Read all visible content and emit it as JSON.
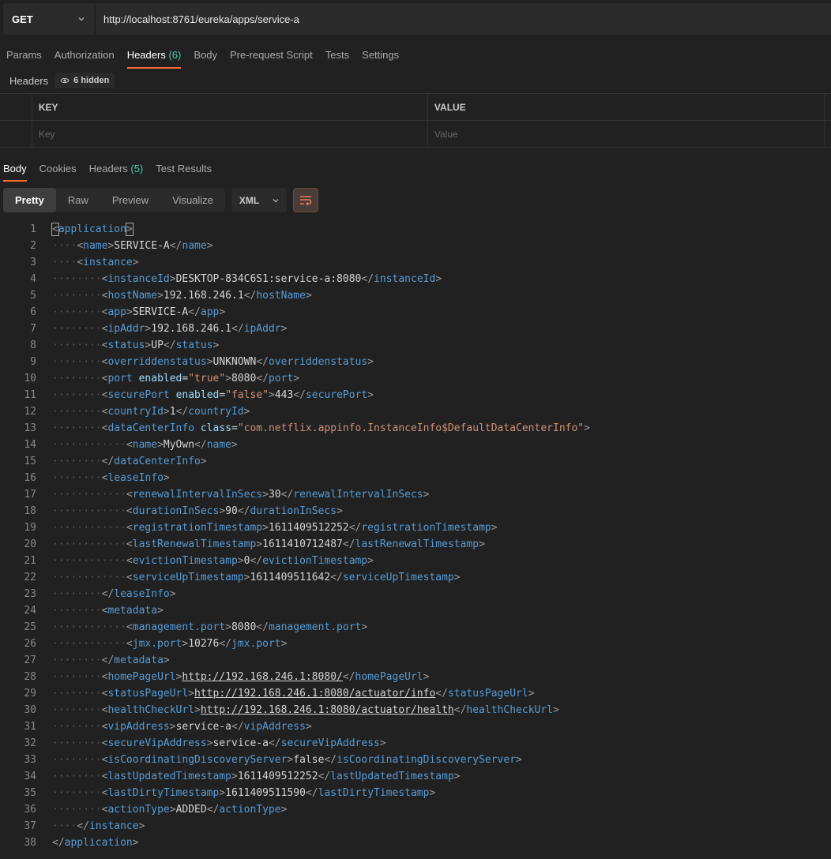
{
  "request": {
    "method": "GET",
    "url": "http://localhost:8761/eureka/apps/service-a"
  },
  "request_tabs": [
    {
      "label": "Params"
    },
    {
      "label": "Authorization"
    },
    {
      "label": "Headers",
      "count": "(6)"
    },
    {
      "label": "Body"
    },
    {
      "label": "Pre-request Script"
    },
    {
      "label": "Tests"
    },
    {
      "label": "Settings"
    }
  ],
  "headers_section": {
    "label": "Headers",
    "hidden_label": "6 hidden"
  },
  "kv_table": {
    "key_header": "KEY",
    "value_header": "VALUE",
    "key_placeholder": "Key",
    "value_placeholder": "Value"
  },
  "response_tabs": [
    {
      "label": "Body"
    },
    {
      "label": "Cookies"
    },
    {
      "label": "Headers",
      "count": "(5)"
    },
    {
      "label": "Test Results"
    }
  ],
  "view_modes": [
    "Pretty",
    "Raw",
    "Preview",
    "Visualize"
  ],
  "format": "XML",
  "colors": {
    "accent": "#ff6c37",
    "tag": "#569cd6",
    "attr": "#9cdcfe",
    "attr_value": "#ce9178",
    "count": "#4ec9b0"
  },
  "code_lines": [
    {
      "n": "1",
      "i": 0,
      "tokens": [
        [
          "br",
          "<"
        ],
        [
          "tg",
          "application"
        ],
        [
          "br",
          ">"
        ]
      ]
    },
    {
      "n": "2",
      "i": 1,
      "tokens": [
        [
          "br",
          "<"
        ],
        [
          "tg",
          "name"
        ],
        [
          "br",
          ">"
        ],
        [
          "tx",
          "SERVICE-A"
        ],
        [
          "br",
          "</"
        ],
        [
          "tg",
          "name"
        ],
        [
          "br",
          ">"
        ]
      ]
    },
    {
      "n": "3",
      "i": 1,
      "tokens": [
        [
          "br",
          "<"
        ],
        [
          "tg",
          "instance"
        ],
        [
          "br",
          ">"
        ]
      ]
    },
    {
      "n": "4",
      "i": 2,
      "tokens": [
        [
          "br",
          "<"
        ],
        [
          "tg",
          "instanceId"
        ],
        [
          "br",
          ">"
        ],
        [
          "tx",
          "DESKTOP-834C6S1:service-a:8080"
        ],
        [
          "br",
          "</"
        ],
        [
          "tg",
          "instanceId"
        ],
        [
          "br",
          ">"
        ]
      ]
    },
    {
      "n": "5",
      "i": 2,
      "tokens": [
        [
          "br",
          "<"
        ],
        [
          "tg",
          "hostName"
        ],
        [
          "br",
          ">"
        ],
        [
          "tx",
          "192.168.246.1"
        ],
        [
          "br",
          "</"
        ],
        [
          "tg",
          "hostName"
        ],
        [
          "br",
          ">"
        ]
      ]
    },
    {
      "n": "6",
      "i": 2,
      "tokens": [
        [
          "br",
          "<"
        ],
        [
          "tg",
          "app"
        ],
        [
          "br",
          ">"
        ],
        [
          "tx",
          "SERVICE-A"
        ],
        [
          "br",
          "</"
        ],
        [
          "tg",
          "app"
        ],
        [
          "br",
          ">"
        ]
      ]
    },
    {
      "n": "7",
      "i": 2,
      "tokens": [
        [
          "br",
          "<"
        ],
        [
          "tg",
          "ipAddr"
        ],
        [
          "br",
          ">"
        ],
        [
          "tx",
          "192.168.246.1"
        ],
        [
          "br",
          "</"
        ],
        [
          "tg",
          "ipAddr"
        ],
        [
          "br",
          ">"
        ]
      ]
    },
    {
      "n": "8",
      "i": 2,
      "tokens": [
        [
          "br",
          "<"
        ],
        [
          "tg",
          "status"
        ],
        [
          "br",
          ">"
        ],
        [
          "tx",
          "UP"
        ],
        [
          "br",
          "</"
        ],
        [
          "tg",
          "status"
        ],
        [
          "br",
          ">"
        ]
      ]
    },
    {
      "n": "9",
      "i": 2,
      "tokens": [
        [
          "br",
          "<"
        ],
        [
          "tg",
          "overriddenstatus"
        ],
        [
          "br",
          ">"
        ],
        [
          "tx",
          "UNKNOWN"
        ],
        [
          "br",
          "</"
        ],
        [
          "tg",
          "overriddenstatus"
        ],
        [
          "br",
          ">"
        ]
      ]
    },
    {
      "n": "10",
      "i": 2,
      "tokens": [
        [
          "br",
          "<"
        ],
        [
          "tg",
          "port"
        ],
        [
          "tx",
          " "
        ],
        [
          "at",
          "enabled"
        ],
        [
          "tx",
          "="
        ],
        [
          "av",
          "\"true\""
        ],
        [
          "br",
          ">"
        ],
        [
          "tx",
          "8080"
        ],
        [
          "br",
          "</"
        ],
        [
          "tg",
          "port"
        ],
        [
          "br",
          ">"
        ]
      ]
    },
    {
      "n": "11",
      "i": 2,
      "tokens": [
        [
          "br",
          "<"
        ],
        [
          "tg",
          "securePort"
        ],
        [
          "tx",
          " "
        ],
        [
          "at",
          "enabled"
        ],
        [
          "tx",
          "="
        ],
        [
          "av",
          "\"false\""
        ],
        [
          "br",
          ">"
        ],
        [
          "tx",
          "443"
        ],
        [
          "br",
          "</"
        ],
        [
          "tg",
          "securePort"
        ],
        [
          "br",
          ">"
        ]
      ]
    },
    {
      "n": "12",
      "i": 2,
      "tokens": [
        [
          "br",
          "<"
        ],
        [
          "tg",
          "countryId"
        ],
        [
          "br",
          ">"
        ],
        [
          "tx",
          "1"
        ],
        [
          "br",
          "</"
        ],
        [
          "tg",
          "countryId"
        ],
        [
          "br",
          ">"
        ]
      ]
    },
    {
      "n": "13",
      "i": 2,
      "tokens": [
        [
          "br",
          "<"
        ],
        [
          "tg",
          "dataCenterInfo"
        ],
        [
          "tx",
          " "
        ],
        [
          "at",
          "class"
        ],
        [
          "tx",
          "="
        ],
        [
          "av",
          "\"com.netflix.appinfo.InstanceInfo$DefaultDataCenterInfo\""
        ],
        [
          "br",
          ">"
        ]
      ]
    },
    {
      "n": "14",
      "i": 3,
      "tokens": [
        [
          "br",
          "<"
        ],
        [
          "tg",
          "name"
        ],
        [
          "br",
          ">"
        ],
        [
          "tx",
          "MyOwn"
        ],
        [
          "br",
          "</"
        ],
        [
          "tg",
          "name"
        ],
        [
          "br",
          ">"
        ]
      ]
    },
    {
      "n": "15",
      "i": 2,
      "tokens": [
        [
          "br",
          "</"
        ],
        [
          "tg",
          "dataCenterInfo"
        ],
        [
          "br",
          ">"
        ]
      ]
    },
    {
      "n": "16",
      "i": 2,
      "tokens": [
        [
          "br",
          "<"
        ],
        [
          "tg",
          "leaseInfo"
        ],
        [
          "br",
          ">"
        ]
      ]
    },
    {
      "n": "17",
      "i": 3,
      "tokens": [
        [
          "br",
          "<"
        ],
        [
          "tg",
          "renewalIntervalInSecs"
        ],
        [
          "br",
          ">"
        ],
        [
          "tx",
          "30"
        ],
        [
          "br",
          "</"
        ],
        [
          "tg",
          "renewalIntervalInSecs"
        ],
        [
          "br",
          ">"
        ]
      ]
    },
    {
      "n": "18",
      "i": 3,
      "tokens": [
        [
          "br",
          "<"
        ],
        [
          "tg",
          "durationInSecs"
        ],
        [
          "br",
          ">"
        ],
        [
          "tx",
          "90"
        ],
        [
          "br",
          "</"
        ],
        [
          "tg",
          "durationInSecs"
        ],
        [
          "br",
          ">"
        ]
      ]
    },
    {
      "n": "19",
      "i": 3,
      "tokens": [
        [
          "br",
          "<"
        ],
        [
          "tg",
          "registrationTimestamp"
        ],
        [
          "br",
          ">"
        ],
        [
          "tx",
          "1611409512252"
        ],
        [
          "br",
          "</"
        ],
        [
          "tg",
          "registrationTimestamp"
        ],
        [
          "br",
          ">"
        ]
      ]
    },
    {
      "n": "20",
      "i": 3,
      "tokens": [
        [
          "br",
          "<"
        ],
        [
          "tg",
          "lastRenewalTimestamp"
        ],
        [
          "br",
          ">"
        ],
        [
          "tx",
          "1611410712487"
        ],
        [
          "br",
          "</"
        ],
        [
          "tg",
          "lastRenewalTimestamp"
        ],
        [
          "br",
          ">"
        ]
      ]
    },
    {
      "n": "21",
      "i": 3,
      "tokens": [
        [
          "br",
          "<"
        ],
        [
          "tg",
          "evictionTimestamp"
        ],
        [
          "br",
          ">"
        ],
        [
          "tx",
          "0"
        ],
        [
          "br",
          "</"
        ],
        [
          "tg",
          "evictionTimestamp"
        ],
        [
          "br",
          ">"
        ]
      ]
    },
    {
      "n": "22",
      "i": 3,
      "tokens": [
        [
          "br",
          "<"
        ],
        [
          "tg",
          "serviceUpTimestamp"
        ],
        [
          "br",
          ">"
        ],
        [
          "tx",
          "1611409511642"
        ],
        [
          "br",
          "</"
        ],
        [
          "tg",
          "serviceUpTimestamp"
        ],
        [
          "br",
          ">"
        ]
      ]
    },
    {
      "n": "23",
      "i": 2,
      "tokens": [
        [
          "br",
          "</"
        ],
        [
          "tg",
          "leaseInfo"
        ],
        [
          "br",
          ">"
        ]
      ]
    },
    {
      "n": "24",
      "i": 2,
      "tokens": [
        [
          "br",
          "<"
        ],
        [
          "tg",
          "metadata"
        ],
        [
          "br",
          ">"
        ]
      ]
    },
    {
      "n": "25",
      "i": 3,
      "tokens": [
        [
          "br",
          "<"
        ],
        [
          "tg",
          "management.port"
        ],
        [
          "br",
          ">"
        ],
        [
          "tx",
          "8080"
        ],
        [
          "br",
          "</"
        ],
        [
          "tg",
          "management.port"
        ],
        [
          "br",
          ">"
        ]
      ]
    },
    {
      "n": "26",
      "i": 3,
      "tokens": [
        [
          "br",
          "<"
        ],
        [
          "tg",
          "jmx.port"
        ],
        [
          "br",
          ">"
        ],
        [
          "tx",
          "10276"
        ],
        [
          "br",
          "</"
        ],
        [
          "tg",
          "jmx.port"
        ],
        [
          "br",
          ">"
        ]
      ]
    },
    {
      "n": "27",
      "i": 2,
      "tokens": [
        [
          "br",
          "</"
        ],
        [
          "tg",
          "metadata"
        ],
        [
          "br",
          ">"
        ]
      ]
    },
    {
      "n": "28",
      "i": 2,
      "tokens": [
        [
          "br",
          "<"
        ],
        [
          "tg",
          "homePageUrl"
        ],
        [
          "br",
          ">"
        ],
        [
          "lk",
          "http://192.168.246.1:8080/"
        ],
        [
          "br",
          "</"
        ],
        [
          "tg",
          "homePageUrl"
        ],
        [
          "br",
          ">"
        ]
      ]
    },
    {
      "n": "29",
      "i": 2,
      "tokens": [
        [
          "br",
          "<"
        ],
        [
          "tg",
          "statusPageUrl"
        ],
        [
          "br",
          ">"
        ],
        [
          "lk",
          "http://192.168.246.1:8080/actuator/info"
        ],
        [
          "br",
          "</"
        ],
        [
          "tg",
          "statusPageUrl"
        ],
        [
          "br",
          ">"
        ]
      ]
    },
    {
      "n": "30",
      "i": 2,
      "tokens": [
        [
          "br",
          "<"
        ],
        [
          "tg",
          "healthCheckUrl"
        ],
        [
          "br",
          ">"
        ],
        [
          "lk",
          "http://192.168.246.1:8080/actuator/health"
        ],
        [
          "br",
          "</"
        ],
        [
          "tg",
          "healthCheckUrl"
        ],
        [
          "br",
          ">"
        ]
      ]
    },
    {
      "n": "31",
      "i": 2,
      "tokens": [
        [
          "br",
          "<"
        ],
        [
          "tg",
          "vipAddress"
        ],
        [
          "br",
          ">"
        ],
        [
          "tx",
          "service-a"
        ],
        [
          "br",
          "</"
        ],
        [
          "tg",
          "vipAddress"
        ],
        [
          "br",
          ">"
        ]
      ]
    },
    {
      "n": "32",
      "i": 2,
      "tokens": [
        [
          "br",
          "<"
        ],
        [
          "tg",
          "secureVipAddress"
        ],
        [
          "br",
          ">"
        ],
        [
          "tx",
          "service-a"
        ],
        [
          "br",
          "</"
        ],
        [
          "tg",
          "secureVipAddress"
        ],
        [
          "br",
          ">"
        ]
      ]
    },
    {
      "n": "33",
      "i": 2,
      "tokens": [
        [
          "br",
          "<"
        ],
        [
          "tg",
          "isCoordinatingDiscoveryServer"
        ],
        [
          "br",
          ">"
        ],
        [
          "tx",
          "false"
        ],
        [
          "br",
          "</"
        ],
        [
          "tg",
          "isCoordinatingDiscoveryServer"
        ],
        [
          "br",
          ">"
        ]
      ]
    },
    {
      "n": "34",
      "i": 2,
      "tokens": [
        [
          "br",
          "<"
        ],
        [
          "tg",
          "lastUpdatedTimestamp"
        ],
        [
          "br",
          ">"
        ],
        [
          "tx",
          "1611409512252"
        ],
        [
          "br",
          "</"
        ],
        [
          "tg",
          "lastUpdatedTimestamp"
        ],
        [
          "br",
          ">"
        ]
      ]
    },
    {
      "n": "35",
      "i": 2,
      "tokens": [
        [
          "br",
          "<"
        ],
        [
          "tg",
          "lastDirtyTimestamp"
        ],
        [
          "br",
          ">"
        ],
        [
          "tx",
          "1611409511590"
        ],
        [
          "br",
          "</"
        ],
        [
          "tg",
          "lastDirtyTimestamp"
        ],
        [
          "br",
          ">"
        ]
      ]
    },
    {
      "n": "36",
      "i": 2,
      "tokens": [
        [
          "br",
          "<"
        ],
        [
          "tg",
          "actionType"
        ],
        [
          "br",
          ">"
        ],
        [
          "tx",
          "ADDED"
        ],
        [
          "br",
          "</"
        ],
        [
          "tg",
          "actionType"
        ],
        [
          "br",
          ">"
        ]
      ]
    },
    {
      "n": "37",
      "i": 1,
      "tokens": [
        [
          "br",
          "</"
        ],
        [
          "tg",
          "instance"
        ],
        [
          "br",
          ">"
        ]
      ]
    },
    {
      "n": "38",
      "i": 0,
      "tokens": [
        [
          "br",
          "</"
        ],
        [
          "tg",
          "application"
        ],
        [
          "br",
          ">"
        ]
      ]
    }
  ]
}
